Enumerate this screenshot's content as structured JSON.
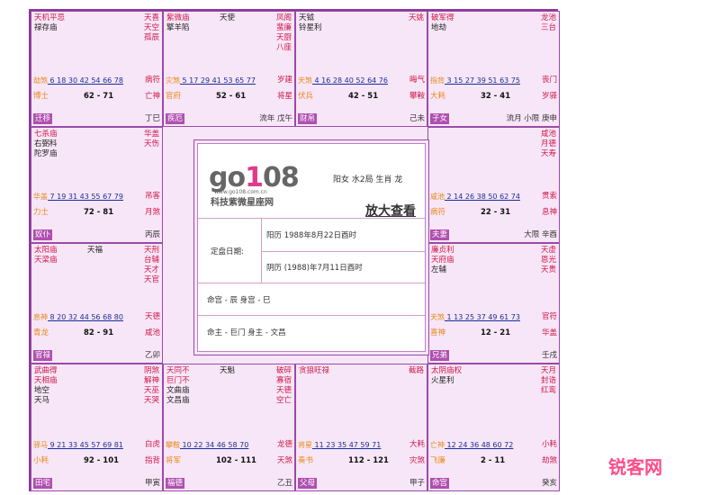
{
  "cells": [
    {
      "key": "si",
      "stars_left": [
        {
          "t": "天机平忌",
          "c": "red"
        },
        {
          "t": "禄存庙",
          "c": "dark"
        }
      ],
      "stars_right": [
        "天喜",
        "天空",
        "孤辰"
      ],
      "ages": "6 18 30 42 54 66 78",
      "age_key": "劫煞",
      "god": "博士",
      "range": "62 - 71",
      "right_top": "病符",
      "right_mid": "亡神",
      "gz": "丁巳",
      "palace": "迁移"
    },
    {
      "key": "wu",
      "stars_left": [
        {
          "t": "紫微庙",
          "c": "red"
        },
        {
          "t": "擎羊陷",
          "c": "dark"
        }
      ],
      "stars_center": [
        "天使"
      ],
      "stars_right": [
        "凤阁",
        "蜚廉",
        "天厨",
        "八座"
      ],
      "ages": "5 17 29 41 53 65 77",
      "age_key": "灾煞",
      "god": "官府",
      "range": "52 - 61",
      "right_top": "岁建",
      "right_mid": "将星",
      "gz": "流年 戊午",
      "palace": "疾厄"
    },
    {
      "key": "wei",
      "stars_left": [
        {
          "t": "天钺",
          "c": "dark"
        },
        {
          "t": "铃星利",
          "c": "dark"
        }
      ],
      "stars_right": [
        "天姚"
      ],
      "ages": "4 16 28 40 52 64 76",
      "age_key": "天煞",
      "god": "伏兵",
      "range": "42 - 51",
      "right_top": "晦气",
      "right_mid": "攀鞍",
      "gz": "己未",
      "palace": "财帛"
    },
    {
      "key": "shen",
      "stars_left": [
        {
          "t": "破军得",
          "c": "red"
        },
        {
          "t": "地劫",
          "c": "dark"
        }
      ],
      "stars_right": [
        "龙池",
        "三台"
      ],
      "ages": "3 15 27 39 51 63 75",
      "age_key": "指背",
      "god": "大耗",
      "range": "32 - 41",
      "right_top": "丧门",
      "right_mid": "岁驿",
      "gz": "流月 小限 庚申",
      "palace": "子女"
    },
    {
      "key": "chen",
      "stars_left": [
        {
          "t": "七杀庙",
          "c": "red"
        },
        {
          "t": "右弼科",
          "c": "dark"
        },
        {
          "t": "陀罗庙",
          "c": "dark"
        }
      ],
      "stars_right": [
        "华盖",
        "天伤"
      ],
      "ages": "7 19 31 43 55 67 79",
      "age_key": "华盖",
      "god": "力士",
      "range": "72 - 81",
      "right_top": "吊客",
      "right_mid": "月煞",
      "gz": "丙辰",
      "palace": "奴仆"
    },
    {
      "key": "you",
      "stars_left": [],
      "stars_right": [
        "咸池",
        "月德",
        "天寿"
      ],
      "ages": "2 14 26 38 50 62 74",
      "age_key": "咸池",
      "god": "病符",
      "range": "22 - 31",
      "right_top": "贯索",
      "right_mid": "息神",
      "gz": "大限 辛酉",
      "palace": "夫妻"
    },
    {
      "key": "mao",
      "stars_left": [
        {
          "t": "太阳庙",
          "c": "red"
        },
        {
          "t": "天梁庙",
          "c": "red"
        }
      ],
      "stars_center": [
        "天福"
      ],
      "stars_right": [
        "天刑",
        "台辅",
        "天才",
        "天官"
      ],
      "ages": "8 20 32 44 56 68 80",
      "age_key": "息神",
      "god": "青龙",
      "range": "82 - 91",
      "right_top": "天德",
      "right_mid": "咸池",
      "gz": "乙卯",
      "palace": "官禄"
    },
    {
      "key": "xu",
      "stars_left": [
        {
          "t": "廉贞利",
          "c": "red"
        },
        {
          "t": "天府庙",
          "c": "red"
        },
        {
          "t": "左辅",
          "c": "dark"
        }
      ],
      "stars_right": [
        "天虚",
        "恩光",
        "天贵"
      ],
      "ages": "1 13 25 37 49 61 73",
      "age_key": "天煞",
      "god": "喜神",
      "range": "12 - 21",
      "right_top": "官符",
      "right_mid": "华盖",
      "gz": "壬戌",
      "palace": "兄弟"
    },
    {
      "key": "yin",
      "stars_left": [
        {
          "t": "武曲得",
          "c": "red"
        },
        {
          "t": "天相庙",
          "c": "red"
        },
        {
          "t": "地空",
          "c": "dark"
        },
        {
          "t": "天马",
          "c": "dark"
        }
      ],
      "stars_right": [
        "阴煞",
        "解神",
        "天巫",
        "天哭"
      ],
      "ages": "9 21 33 45 57 69 81",
      "age_key": "驿马",
      "god": "小耗",
      "range": "92 - 101",
      "right_top": "白虎",
      "right_mid": "指背",
      "gz": "甲寅",
      "palace": "田宅"
    },
    {
      "key": "chou",
      "stars_left": [
        {
          "t": "天同不",
          "c": "red"
        },
        {
          "t": "巨门不",
          "c": "red"
        },
        {
          "t": "文曲庙",
          "c": "dark"
        },
        {
          "t": "文昌庙",
          "c": "dark"
        }
      ],
      "stars_center": [
        "天魁"
      ],
      "stars_right": [
        "破碎",
        "寡宿",
        "天德",
        "空亡"
      ],
      "ages": "10 22 34 46 58 70",
      "age_key": "攀鞍",
      "god": "将军",
      "range": "102 - 111",
      "right_top": "龙德",
      "right_mid": "天煞",
      "gz": "乙丑",
      "palace": "福德"
    },
    {
      "key": "zi",
      "stars_left": [
        {
          "t": "贪狼旺禄",
          "c": "red"
        }
      ],
      "stars_right": [
        "截路"
      ],
      "ages": "11 23 35 47 59 71",
      "age_key": "将星",
      "god": "奏书",
      "range": "112 - 121",
      "right_top": "大耗",
      "right_mid": "灾煞",
      "gz": "甲子",
      "palace": "父母"
    },
    {
      "key": "hai",
      "stars_left": [
        {
          "t": "太阴庙权",
          "c": "red"
        },
        {
          "t": "火星利",
          "c": "dark"
        }
      ],
      "stars_right": [
        "天月",
        "封诰",
        "红鸾"
      ],
      "ages": "12 24 36 48 60 72",
      "age_key": "亡神",
      "god": "飞廉",
      "range": "2 - 11",
      "right_top": "小耗",
      "right_mid": "劫煞",
      "gz": "癸亥",
      "palace": "命宫"
    }
  ],
  "center": {
    "logo": "go108",
    "url": "www.go108.com.cn",
    "brand": "科技紫微星座网",
    "person": "阳女  水2局  生肖 龙",
    "zoom": "放大查看",
    "date_label": "定盘日期:",
    "solar": "阳历 1988年8月22日酉时",
    "lunar": "阴历 (1988)年7月11日酉时",
    "ming": "命宫 - 辰    身宫 - 巳",
    "zhu": "命主 - 巨门    身主 - 文昌"
  },
  "watermark": "锐客网"
}
